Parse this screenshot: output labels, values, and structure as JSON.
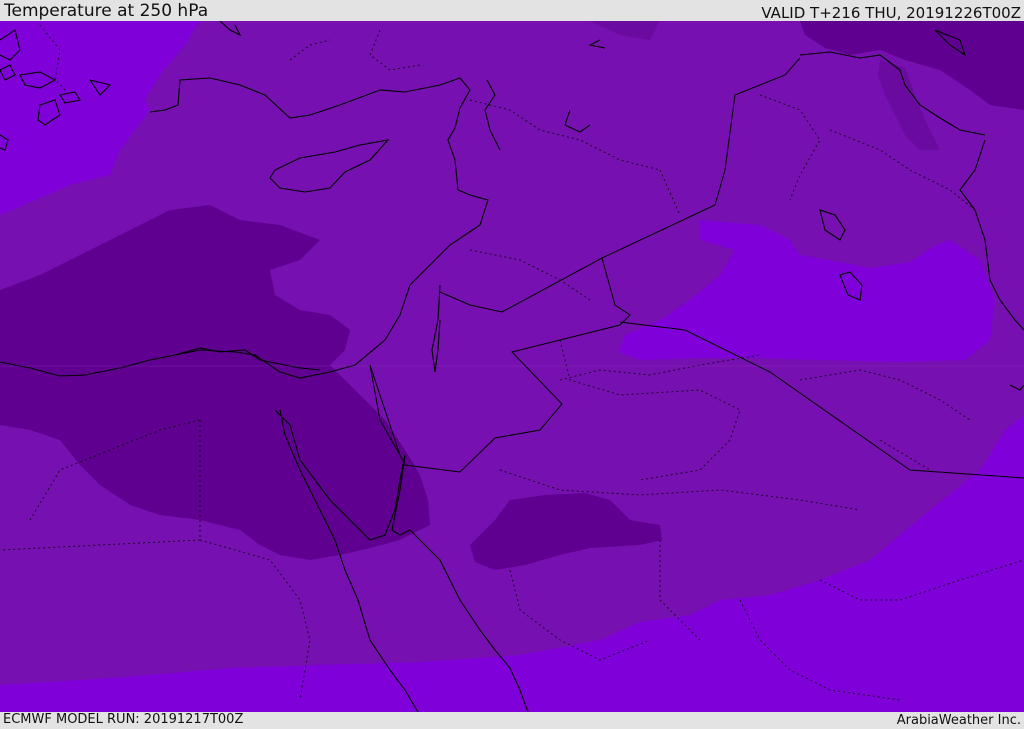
{
  "header": {
    "title": "Temperature at 250 hPa",
    "valid_time": "VALID T+216 THU, 20191226T00Z"
  },
  "footer": {
    "model_run": "ECMWF MODEL RUN: 20191217T00Z",
    "credit": "ArabiaWeather Inc."
  },
  "map": {
    "colors": {
      "band_warmest": "#8000da",
      "band_mid": "#7710b0",
      "band_cold": "#6a0a9e",
      "band_coldest": "#5f0090",
      "coastline": "#000000",
      "border": "#000000"
    }
  }
}
